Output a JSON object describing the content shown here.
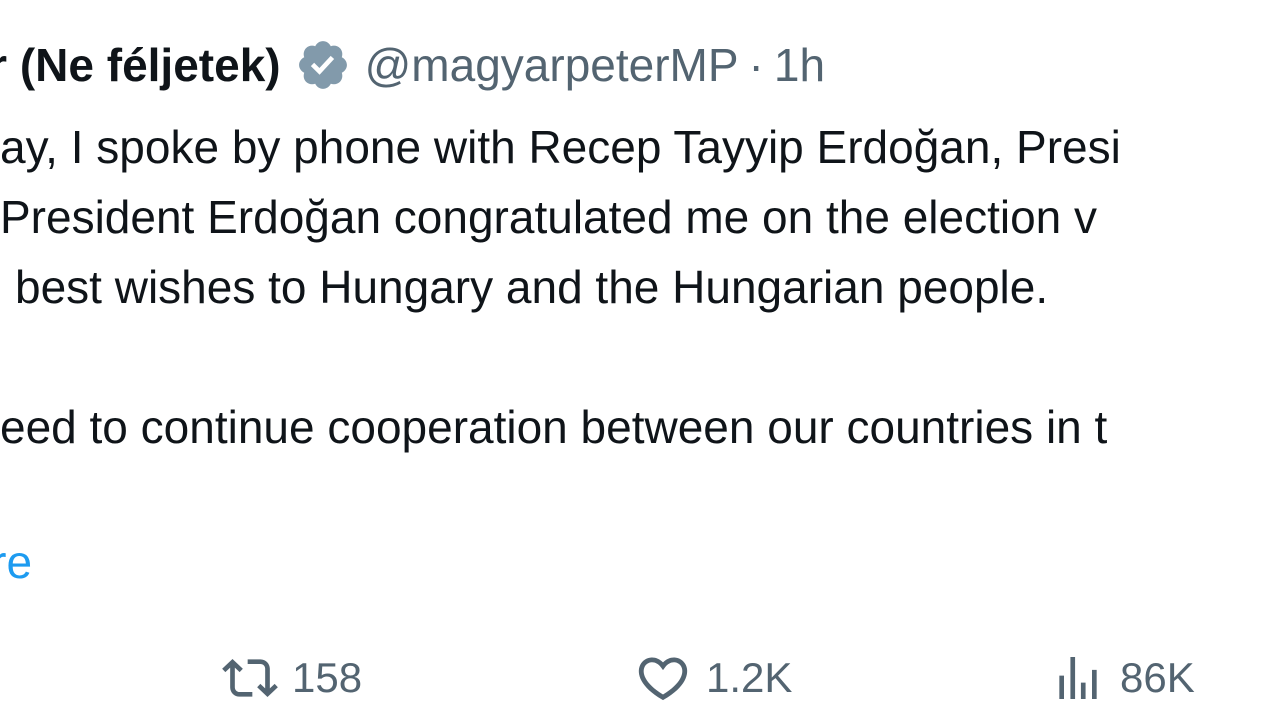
{
  "tweet": {
    "display_name": "Péter (Ne féljetek)",
    "handle": "@magyarpeterMP",
    "separator": "·",
    "time": "1h",
    "body_lines": [
      "ay, I spoke by phone with Recep Tayyip Erdoğan, Presi",
      "President Erdoğan congratulated me on the election v",
      "best wishes to Hungary and the Hungarian people.",
      "",
      "eed to continue cooperation between our countries in t",
      "."
    ],
    "show_more": "nore"
  },
  "actions": {
    "retweet": {
      "icon": "retweet-icon",
      "count": "158"
    },
    "like": {
      "icon": "heart-icon",
      "count": "1.2K"
    },
    "views": {
      "icon": "views-chart-icon",
      "count": "86K"
    }
  },
  "colors": {
    "text": "#0f1419",
    "secondary": "#536471",
    "link": "#1d9bf0",
    "verified_badge": "#829aab"
  }
}
